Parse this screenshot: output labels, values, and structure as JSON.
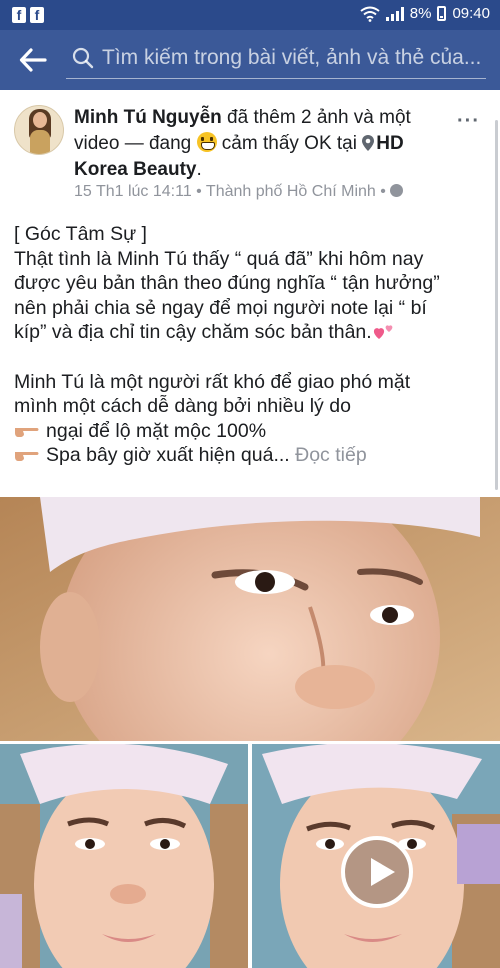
{
  "status_bar": {
    "battery": "8%",
    "time": "09:40"
  },
  "search": {
    "placeholder": "Tìm kiếm trong bài viết, ảnh và thẻ của..."
  },
  "post": {
    "author": "Minh Tú Nguyễn",
    "action": " đã thêm 2 ảnh và một video — đang ",
    "feeling": " cảm thấy OK tại ",
    "place": "HD Korea Beauty",
    "date": "15 Th1 lúc 14:11",
    "location": "Thành phố Hồ Chí Minh",
    "separator": " • ",
    "lines": {
      "l1": "[ Góc Tâm Sự ]",
      "l2": "Thật tình là Minh Tú thấy “ quá đã” khi hôm nay",
      "l3": "được yêu bản thân theo đúng nghĩa “ tận hưởng”",
      "l4": "nên phải chia sẻ ngay để mọi người note lại “ bí",
      "l5": "kíp” và địa chỉ tin cậy chăm sóc bản thân.",
      "l6": "Minh Tú là một người rất khó để giao phó mặt",
      "l7": "mình một cách dễ dàng bởi nhiều lý do",
      "l8": "ngại để lộ mặt mộc 100%",
      "l9": "Spa bây giờ xuất hiện quá...",
      "read_more": "Đọc tiếp"
    }
  },
  "icons": {
    "back": "arrow-left-icon",
    "search": "search-icon",
    "more": "more-horizontal-icon",
    "location": "location-pin-icon",
    "privacy": "globe-icon",
    "play": "play-icon"
  },
  "colors": {
    "status_bar": "#2b4a8b",
    "header": "#3b5998",
    "meta_text": "#90949c"
  }
}
